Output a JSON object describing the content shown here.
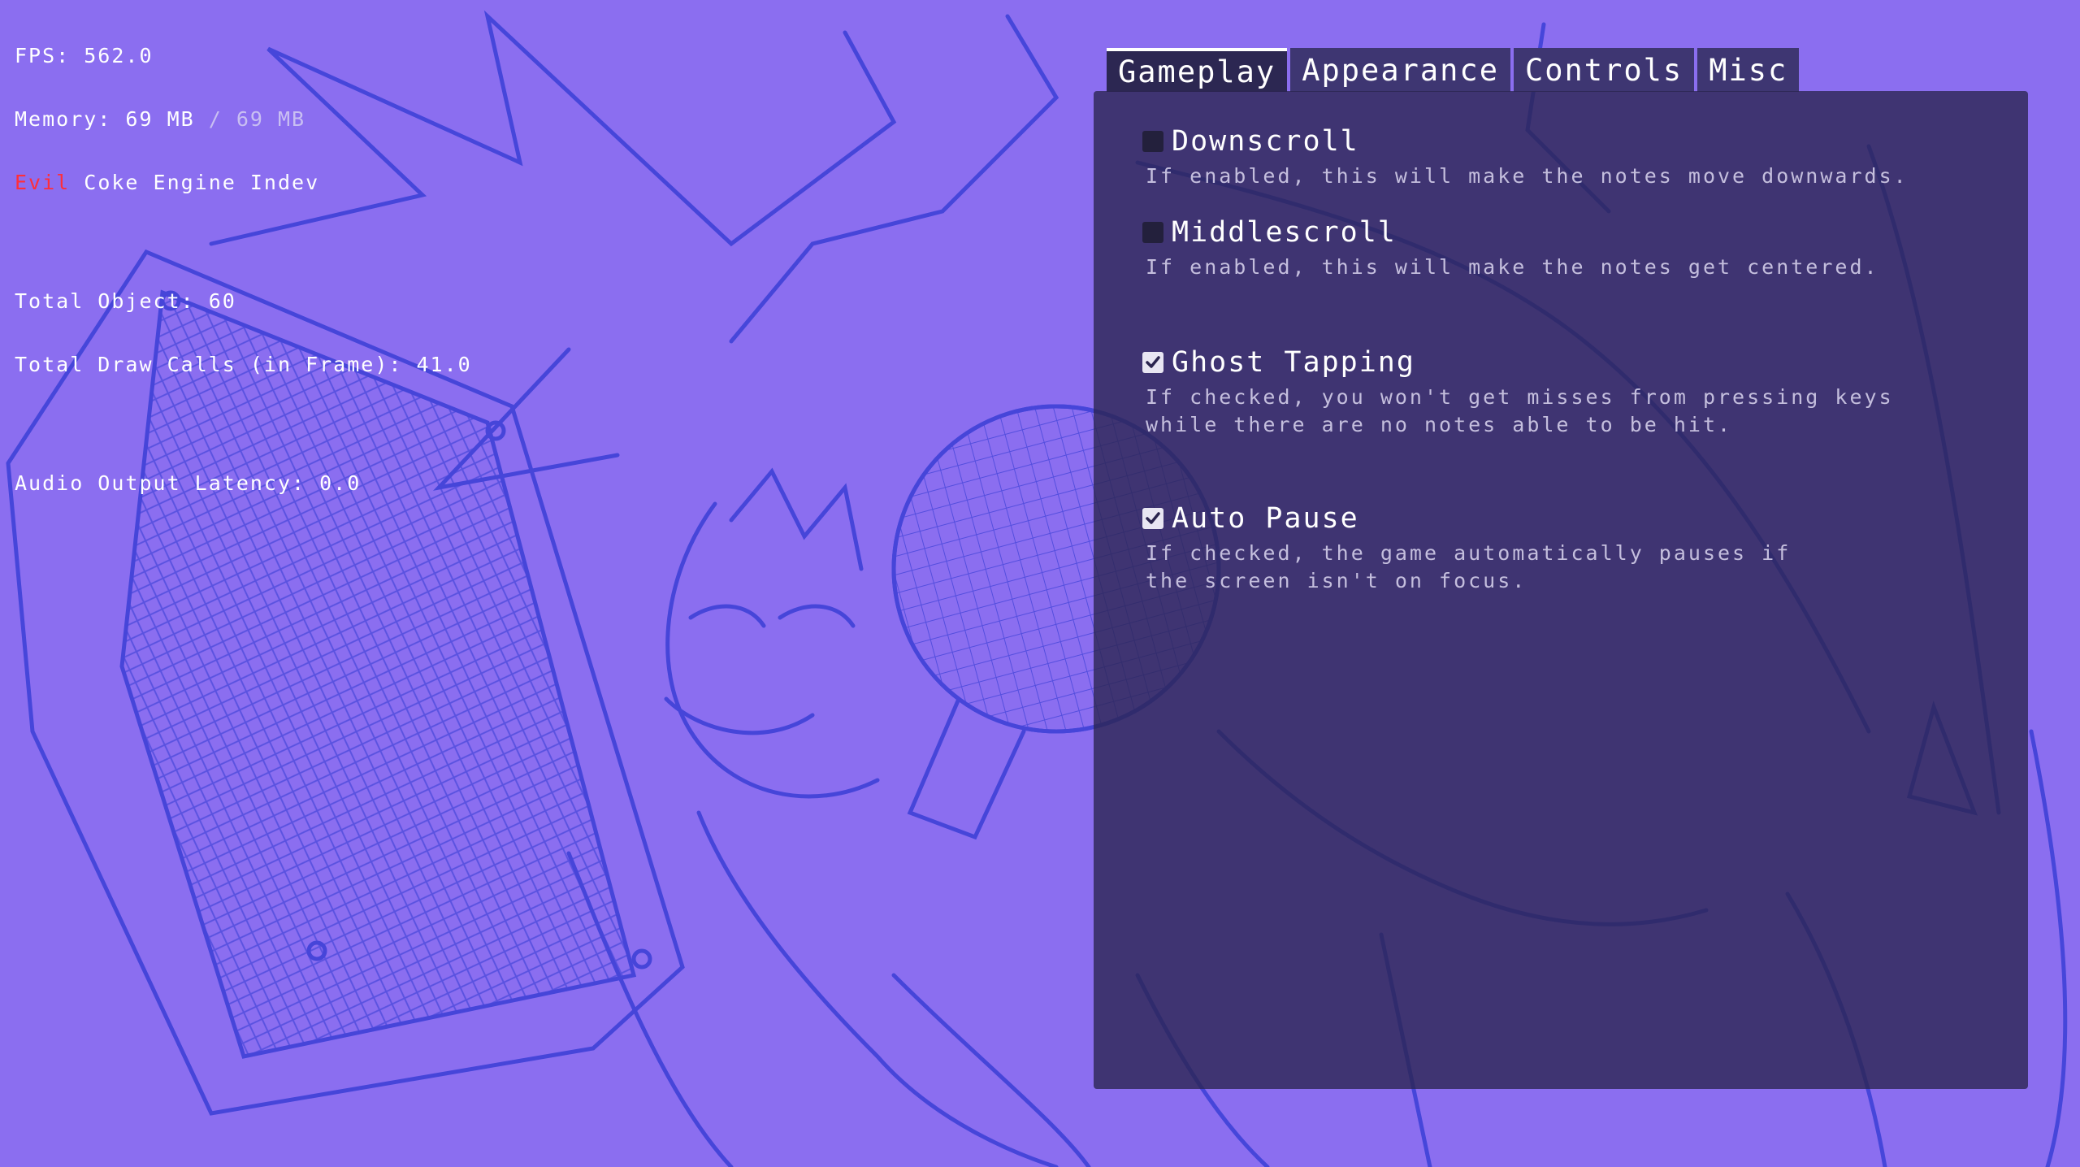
{
  "debug": {
    "fps": "FPS: 562.0",
    "memory_used": "Memory: 69 MB",
    "memory_peak": " / 69 MB",
    "engine_red": "Evil",
    "engine_rest": " Coke Engine Indev",
    "total_objects": "Total Object: 60",
    "draw_calls": "Total Draw Calls (in Frame): 41.0",
    "audio_latency": "Audio Output Latency: 0.0"
  },
  "tabs": [
    {
      "label": "Gameplay",
      "active": true
    },
    {
      "label": "Appearance",
      "active": false
    },
    {
      "label": "Controls",
      "active": false
    },
    {
      "label": "Misc",
      "active": false
    }
  ],
  "options": [
    {
      "label": "Downscroll",
      "checked": false,
      "description": "If enabled, this will make the notes move downwards."
    },
    {
      "label": "Middlescroll",
      "checked": false,
      "description": "If enabled, this will make the notes get centered."
    },
    {
      "label": "Ghost Tapping",
      "checked": true,
      "description": "If checked, you won't get misses from pressing keys\nwhile there are no notes able to be hit."
    },
    {
      "label": "Auto Pause",
      "checked": true,
      "description": "If checked, the game automatically pauses if\nthe screen isn't on focus."
    }
  ],
  "colors": {
    "background": "#8b6ef0",
    "sketch_lines": "#3a3fd6",
    "panel": "#2a244e",
    "engine_label": "#ff2e3a"
  },
  "icons": {
    "checkbox_checked": "check-icon"
  }
}
